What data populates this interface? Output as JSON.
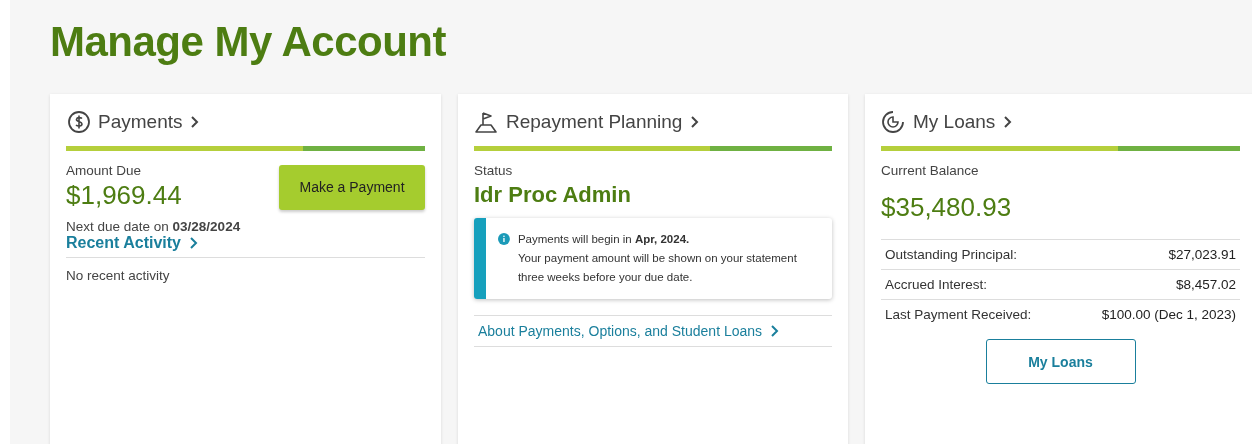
{
  "page_title": "Manage My Account",
  "cards": [
    {
      "kind": "payments",
      "title": "Payments",
      "amount_label": "Amount Due",
      "amount": "$1,969.44",
      "button": "Make a Payment",
      "due_text": "Next due date on **03/28/2024**",
      "activity_link": "Recent Activity",
      "activity_empty": "No recent activity"
    },
    {
      "kind": "planning",
      "title": "Repayment Planning",
      "status_label": "Status",
      "status": "Idr Proc Admin",
      "notice_lines": [
        "Payments will begin in **Apr, 2024.**",
        "Your payment amount will be shown on your statement three weeks before your due date."
      ],
      "link": "About Payments, Options, and Student Loans"
    },
    {
      "kind": "loans",
      "title": "My Loans",
      "balance_label": "Current Balance",
      "balance": "$35,480.93",
      "rows": [
        {
          "label": "Outstanding Principal:",
          "value": "$27,023.91"
        },
        {
          "label": "Accrued Interest:",
          "value": "$8,457.02"
        },
        {
          "label": "Last Payment Received:",
          "value": "$100.00 (Dec 1, 2023)"
        }
      ],
      "button": "My Loans"
    }
  ]
}
